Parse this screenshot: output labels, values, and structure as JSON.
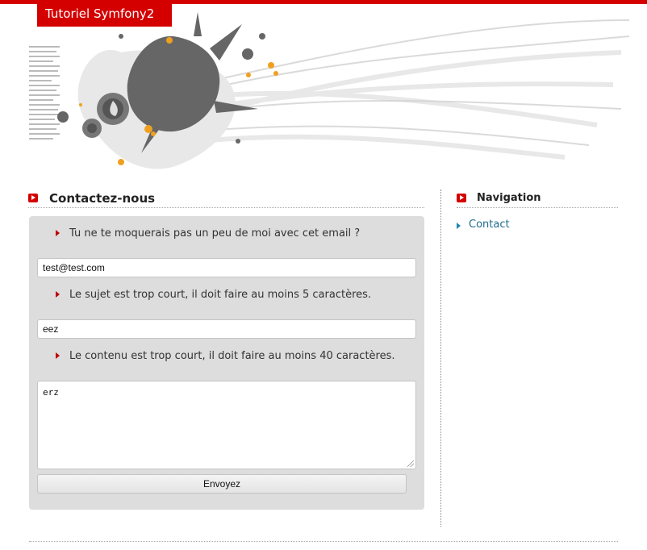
{
  "site": {
    "title": "Tutoriel Symfony2"
  },
  "contact": {
    "heading": "Contactez-nous",
    "errors": {
      "email": "Tu ne te moquerais pas un peu de moi avec cet email ?",
      "subject": "Le sujet est trop court, il doit faire au moins 5 caractères.",
      "content": "Le contenu est trop court, il doit faire au moins 40 caractères."
    },
    "fields": {
      "email": "test@test.com",
      "subject": "eez",
      "content": "erz"
    },
    "submit_label": "Envoyez"
  },
  "navigation": {
    "heading": "Navigation",
    "items": [
      {
        "label": "Contact"
      }
    ]
  },
  "colors": {
    "accent": "#d40000",
    "link": "#1e6e8c",
    "form_bg": "#dddddd"
  }
}
